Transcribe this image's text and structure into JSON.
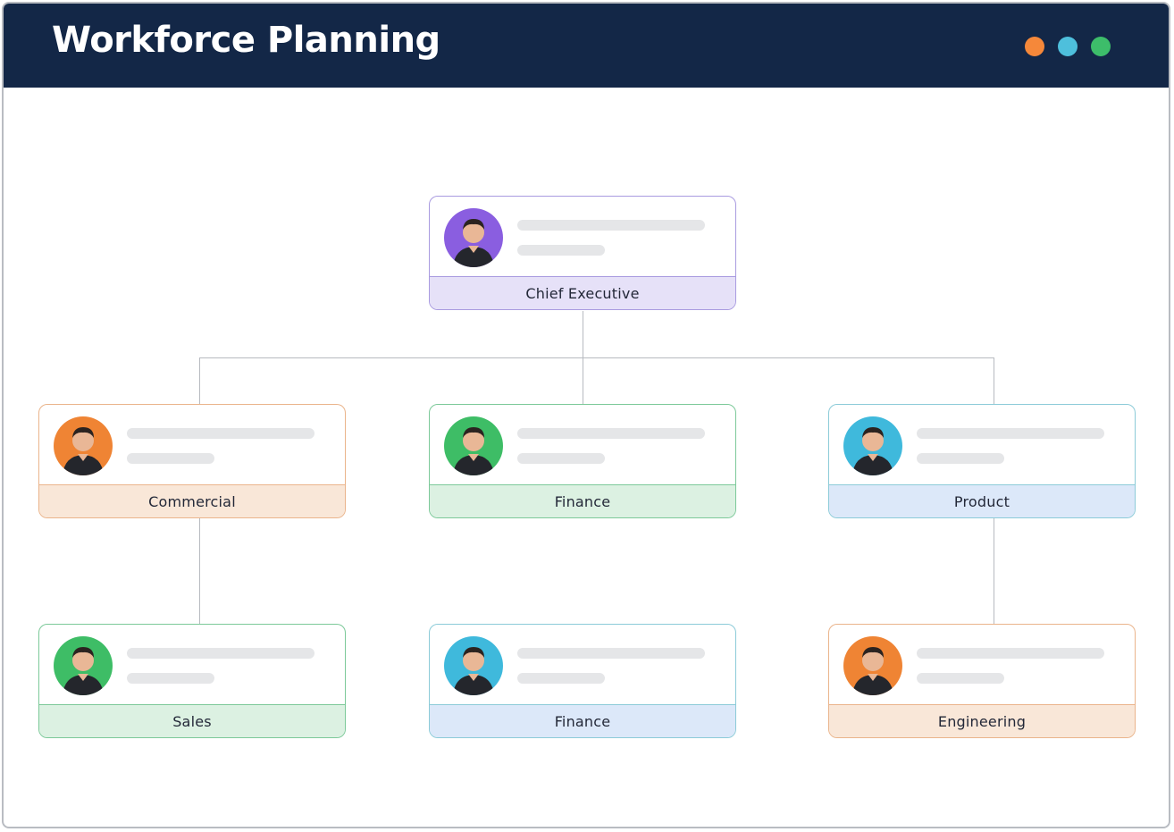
{
  "window": {
    "title": "Workforce Planning",
    "controls": [
      {
        "name": "orange-dot",
        "color": "#f5883a"
      },
      {
        "name": "blue-dot",
        "color": "#4ebfdc"
      },
      {
        "name": "green-dot",
        "color": "#3dbd6a"
      }
    ]
  },
  "org_chart": {
    "nodes": [
      {
        "id": "chief-executive",
        "role": "Chief Executive",
        "parent": null,
        "theme": "purple",
        "avatar_bg": "#8a5ee0",
        "border": "#a99be0",
        "label_bg": "#e6e1f8"
      },
      {
        "id": "commercial",
        "role": "Commercial",
        "parent": "chief-executive",
        "theme": "orange",
        "avatar_bg": "#ef8434",
        "border": "#eab48b",
        "label_bg": "#f9e7d8"
      },
      {
        "id": "finance-1",
        "role": "Finance",
        "parent": "chief-executive",
        "theme": "green",
        "avatar_bg": "#3ebd66",
        "border": "#7cc999",
        "label_bg": "#dcf1e2"
      },
      {
        "id": "product",
        "role": "Product",
        "parent": "chief-executive",
        "theme": "blue",
        "avatar_bg": "#3fb9dc",
        "border": "#8ccbd8",
        "label_bg": "#dce8f9"
      },
      {
        "id": "sales",
        "role": "Sales",
        "parent": "commercial",
        "theme": "green",
        "avatar_bg": "#3ebd66",
        "border": "#7cc999",
        "label_bg": "#dcf1e2"
      },
      {
        "id": "finance-2",
        "role": "Finance",
        "parent": null,
        "theme": "blue",
        "avatar_bg": "#3fb9dc",
        "border": "#8ccbd8",
        "label_bg": "#dce8f9"
      },
      {
        "id": "engineering",
        "role": "Engineering",
        "parent": "product",
        "theme": "orange",
        "avatar_bg": "#ef8434",
        "border": "#eab48b",
        "label_bg": "#f9e7d8"
      }
    ]
  }
}
